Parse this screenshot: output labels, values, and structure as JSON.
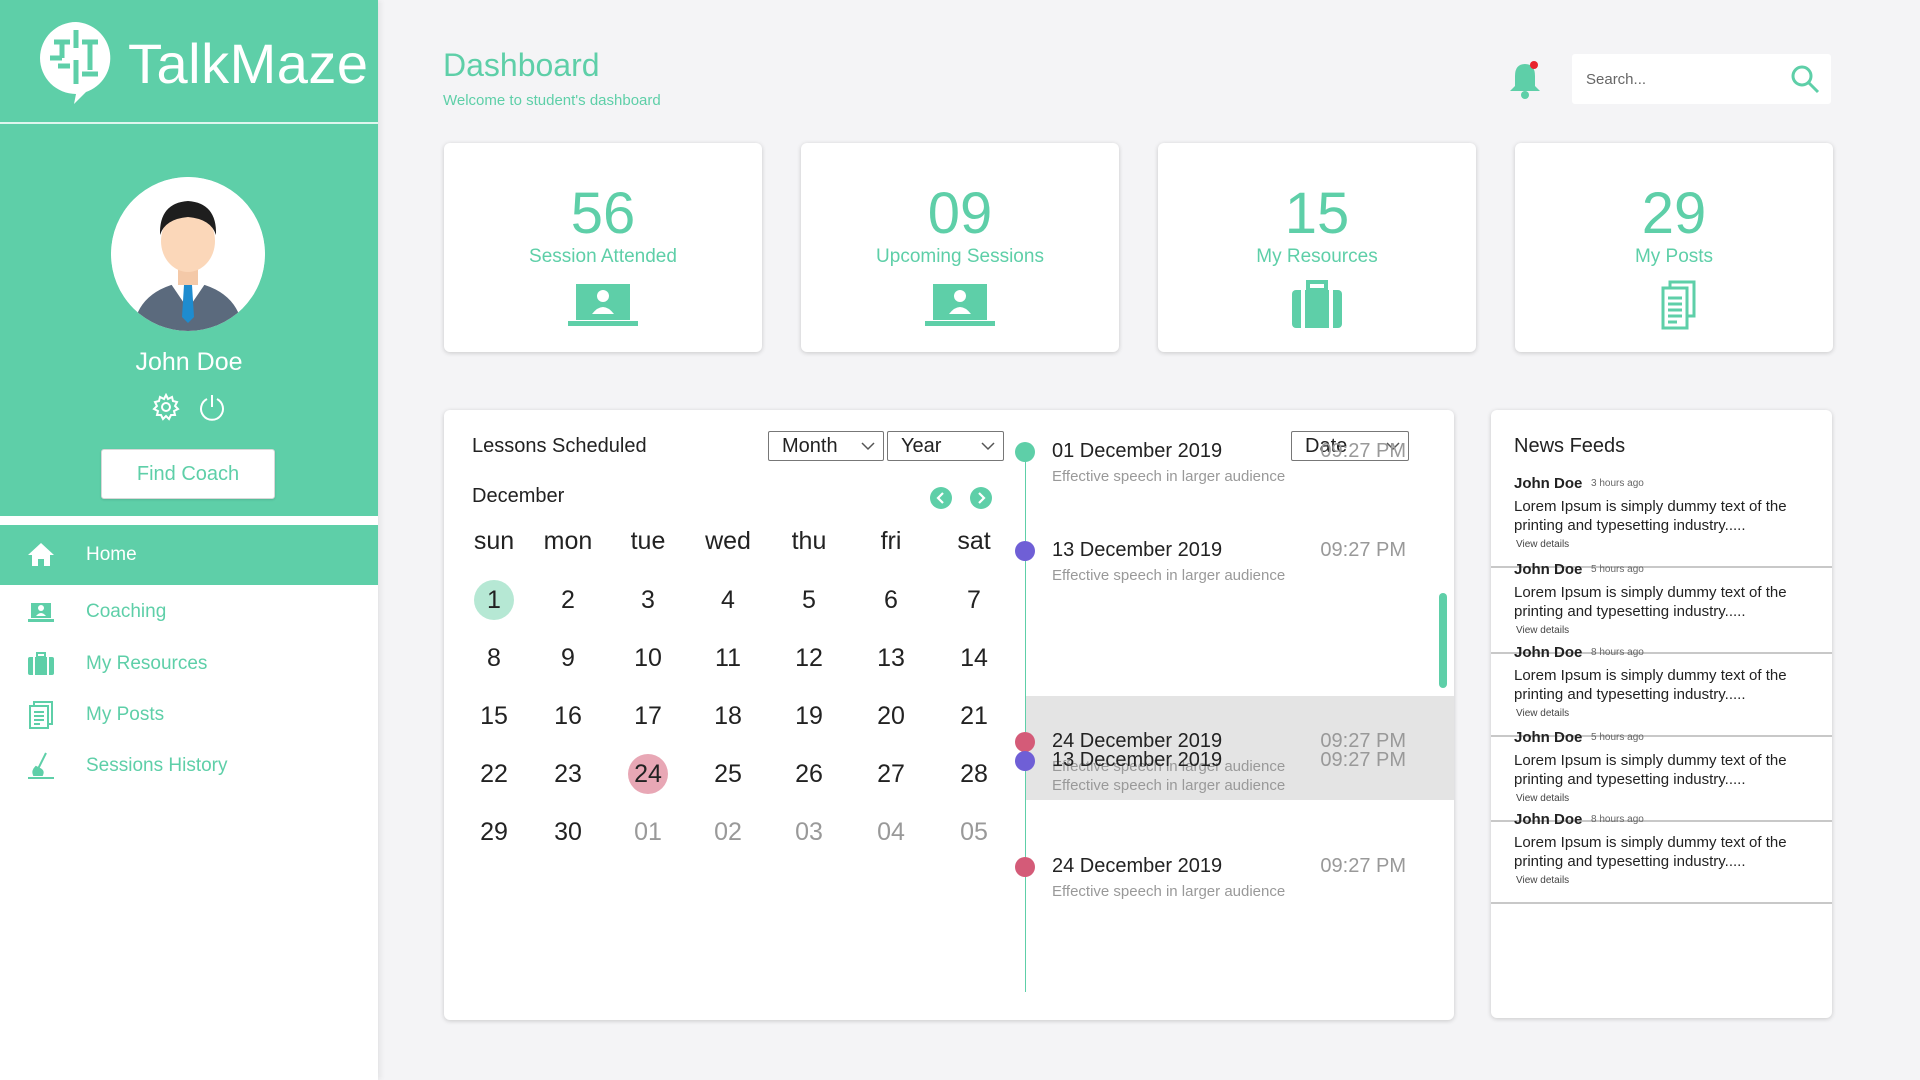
{
  "brand": {
    "name": "TalkMaze",
    "color": "#5ecfa8"
  },
  "user": {
    "name": "John Doe"
  },
  "sidebar": {
    "find_coach_label": "Find Coach",
    "items": [
      {
        "label": "Home",
        "icon": "home-icon"
      },
      {
        "label": "Coaching",
        "icon": "laptop-user-icon"
      },
      {
        "label": "My Resources",
        "icon": "briefcase-icon"
      },
      {
        "label": "My Posts",
        "icon": "document-icon"
      },
      {
        "label": "Sessions History",
        "icon": "writing-hand-icon"
      }
    ]
  },
  "header": {
    "title": "Dashboard",
    "subtitle": "Welcome to student's dashboard",
    "search_placeholder": "Search..."
  },
  "stats": [
    {
      "value": "56",
      "label": "Session Attended",
      "icon": "laptop-user-icon"
    },
    {
      "value": "09",
      "label": "Upcoming Sessions",
      "icon": "laptop-user-icon"
    },
    {
      "value": "15",
      "label": "My Resources",
      "icon": "briefcase-icon"
    },
    {
      "value": "29",
      "label": "My Posts",
      "icon": "document-icon"
    }
  ],
  "lessons": {
    "title": "Lessons Scheduled",
    "filters": {
      "month": "Month",
      "year": "Year",
      "date": "Date"
    },
    "month_label": "December",
    "weekdays": [
      "sun",
      "mon",
      "tue",
      "wed",
      "thu",
      "fri",
      "sat"
    ],
    "days": [
      "1",
      "2",
      "3",
      "4",
      "5",
      "6",
      "7",
      "8",
      "9",
      "10",
      "11",
      "12",
      "13",
      "14",
      "15",
      "16",
      "17",
      "18",
      "19",
      "20",
      "21",
      "22",
      "23",
      "24",
      "25",
      "26",
      "27",
      "28",
      "29",
      "30",
      "01",
      "02",
      "03",
      "04",
      "05"
    ],
    "today_day": "1",
    "selected_day": "24",
    "events": [
      {
        "date": "01 December 2019",
        "time": "09:27 PM",
        "desc": "Effective speech in larger audience",
        "color": "#5ecfa8"
      },
      {
        "date": "13 December 2019",
        "time": "09:27 PM",
        "desc": "Effective speech in larger audience",
        "color": "#6f5fd6"
      },
      {
        "date": "24 December 2019",
        "time": "09:27 PM",
        "desc": "Effective speech in larger audience",
        "color": "#d45b78"
      },
      {
        "date": "13 December 2019",
        "time": "09:27 PM",
        "desc": "Effective speech in larger audience",
        "color": "#6f5fd6"
      },
      {
        "date": "24 December 2019",
        "time": "09:27 PM",
        "desc": "Effective speech in larger audience",
        "color": "#d45b78"
      }
    ]
  },
  "news": {
    "title": "News Feeds",
    "link_label": "View details",
    "items": [
      {
        "author": "John Doe",
        "time": "3 hours ago",
        "text": "Lorem Ipsum is simply dummy text of the printing and typesetting industry....."
      },
      {
        "author": "John Doe",
        "time": "5 hours ago",
        "text": "Lorem Ipsum is simply dummy text of the printing and typesetting industry....."
      },
      {
        "author": "John Doe",
        "time": "8 hours ago",
        "text": "Lorem Ipsum is simply dummy text of the printing and typesetting industry....."
      },
      {
        "author": "John Doe",
        "time": "5 hours ago",
        "text": "Lorem Ipsum is simply dummy text of the printing and typesetting industry....."
      },
      {
        "author": "John Doe",
        "time": "8 hours ago",
        "text": "Lorem Ipsum is simply dummy text of the printing and typesetting industry....."
      }
    ]
  }
}
